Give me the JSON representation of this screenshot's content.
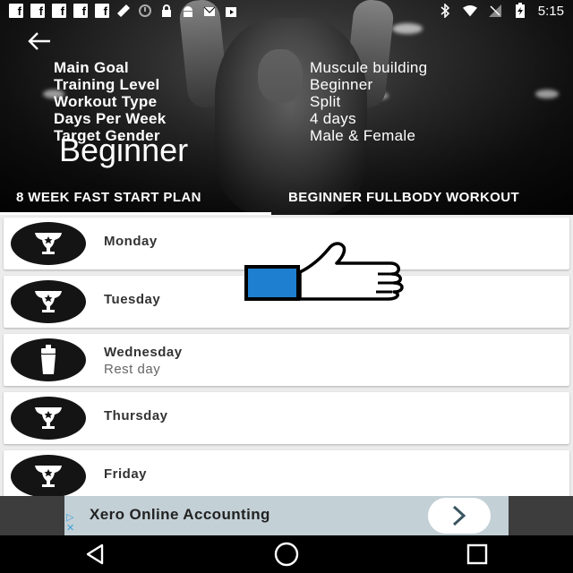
{
  "status_bar": {
    "time": "5:15",
    "left_icons": [
      "facebook-icon",
      "facebook-icon",
      "facebook-icon",
      "facebook-icon",
      "facebook-icon",
      "fitness-icon",
      "sync-icon",
      "lock-icon",
      "android-icon",
      "mail-icon",
      "play-store-icon"
    ],
    "right_icons": [
      "bluetooth-icon",
      "wifi-icon",
      "no-signal-icon",
      "battery-charging-icon"
    ]
  },
  "header": {
    "info": [
      {
        "label": "Main Goal",
        "value": "Muscule building"
      },
      {
        "label": "Training Level",
        "value": "Beginner"
      },
      {
        "label": "Workout Type",
        "value": "Split"
      },
      {
        "label": "Days Per Week",
        "value": "4 days"
      },
      {
        "label": "Target Gender",
        "value": "Male & Female"
      }
    ],
    "level_title": "Beginner"
  },
  "tabs": [
    {
      "label": "8 WEEK FAST START PLAN",
      "selected": true
    },
    {
      "label": "BEGINNER FULLBODY WORKOUT",
      "selected": false
    }
  ],
  "days": [
    {
      "day": "Monday",
      "subtitle": "",
      "icon": "trophy-icon"
    },
    {
      "day": "Tuesday",
      "subtitle": "",
      "icon": "trophy-icon"
    },
    {
      "day": "Wednesday",
      "subtitle": "Rest day",
      "icon": "shaker-bottle-icon"
    },
    {
      "day": "Thursday",
      "subtitle": "",
      "icon": "trophy-icon"
    },
    {
      "day": "Friday",
      "subtitle": "",
      "icon": "trophy-icon"
    }
  ],
  "ad": {
    "title": "Xero Online Accounting"
  },
  "colors": {
    "thumb_cuff": "#1e7fd0",
    "ad_background": "#c3d0d6",
    "list_background": "#ececec"
  }
}
